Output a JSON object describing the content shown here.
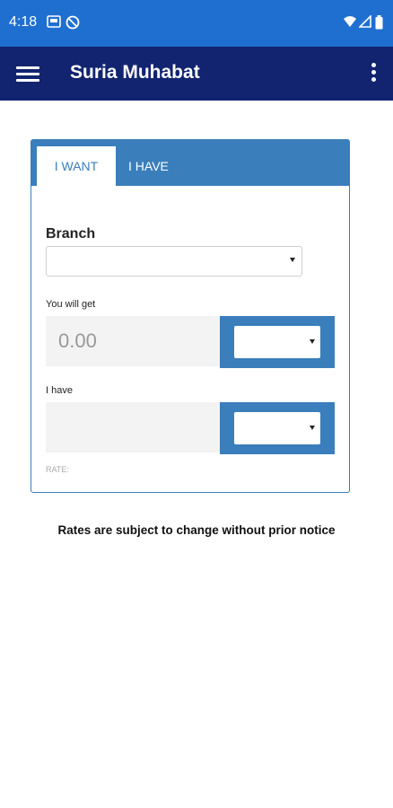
{
  "status_bar": {
    "time": "4:18"
  },
  "app_bar": {
    "title": "Suria Muhabat"
  },
  "tabs": {
    "want": "I WANT",
    "have": "I HAVE"
  },
  "form": {
    "branch_label": "Branch",
    "branch_value": "",
    "get_label": "You will get",
    "get_amount": "0.00",
    "get_currency": "",
    "have_label": "I have",
    "have_amount": "",
    "have_currency": "",
    "rate_label": "RATE:"
  },
  "notice": "Rates are subject to change without prior notice",
  "colors": {
    "status": "#1f6fd1",
    "appbar": "#122470",
    "accent": "#3a7ebc"
  }
}
